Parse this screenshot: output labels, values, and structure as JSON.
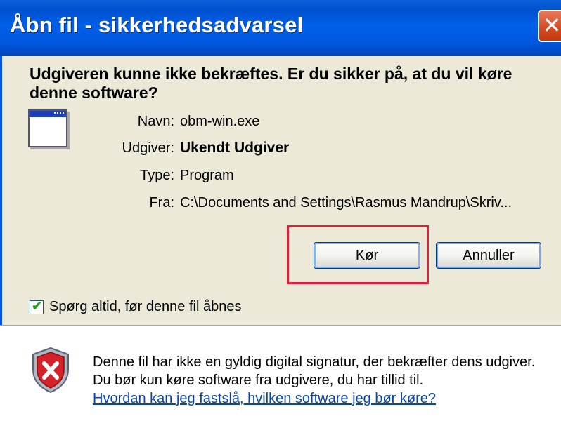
{
  "window": {
    "title": "Åbn fil - sikkerhedsadvarsel",
    "close_label": "✕"
  },
  "question": "Udgiveren kunne ikke bekræftes.  Er du sikker på, at du vil køre denne software?",
  "details": {
    "name_label": "Navn:",
    "name_value": "obm-win.exe",
    "publisher_label": "Udgiver:",
    "publisher_value": "Ukendt Udgiver",
    "type_label": "Type:",
    "type_value": "Program",
    "from_label": "Fra:",
    "from_value": "C:\\Documents and Settings\\Rasmus Mandrup\\Skriv..."
  },
  "buttons": {
    "run_label": "Kør",
    "cancel_label": "Annuller"
  },
  "checkbox": {
    "label": "Spørg altid, før denne fil åbnes",
    "checked": true
  },
  "info": {
    "text": "Denne fil har ikke en gyldig digital signatur, der bekræfter dens udgiver.  Du bør kun køre software fra udgivere, du har tillid til.",
    "link": "Hvordan kan jeg fastslå, hvilken software jeg bør køre?"
  },
  "colors": {
    "titlebar": "#0058e0",
    "highlight": "#e0203a",
    "link": "#0645ad"
  }
}
